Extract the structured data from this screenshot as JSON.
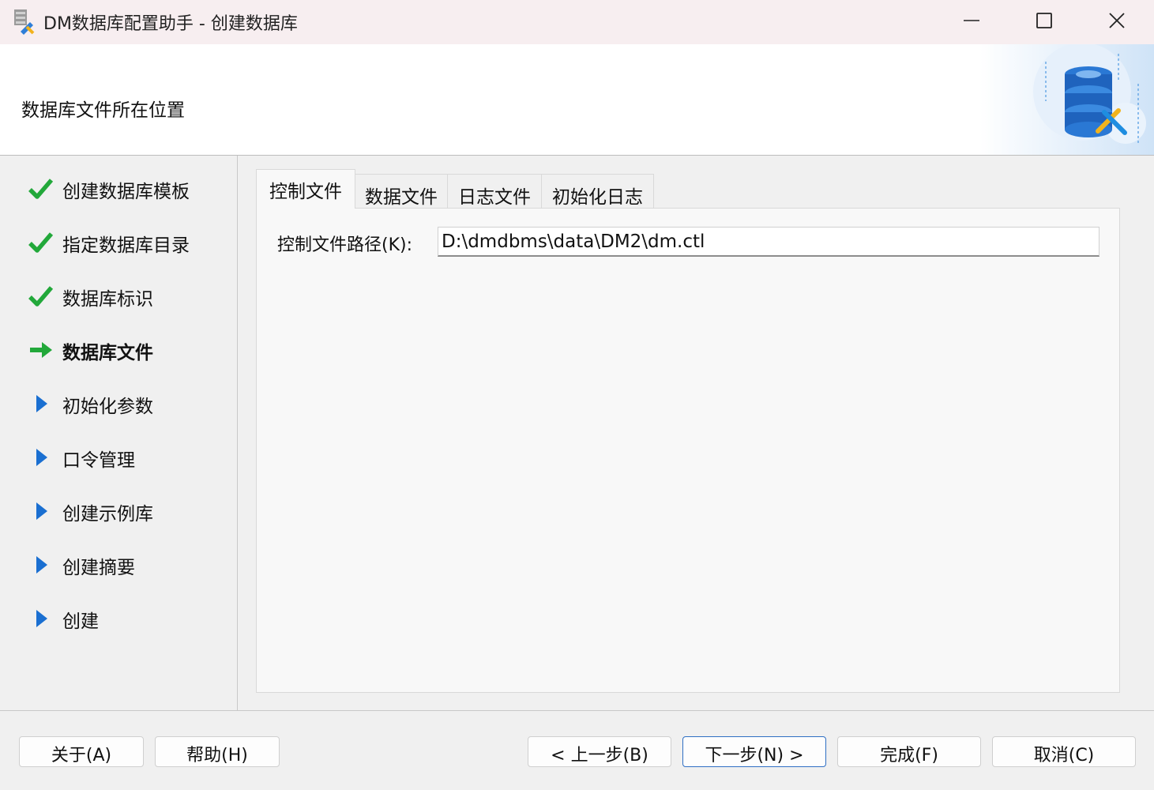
{
  "window": {
    "title": "DM数据库配置助手 - 创建数据库",
    "app_icon": "db-wrench-icon",
    "controls": [
      "minimize-icon",
      "maximize-icon",
      "close-icon"
    ]
  },
  "header": {
    "title": "数据库文件所在位置",
    "art_icon": "database-wrench-illustration"
  },
  "steps": [
    {
      "label": "创建数据库模板",
      "status": "done"
    },
    {
      "label": "指定数据库目录",
      "status": "done"
    },
    {
      "label": "数据库标识",
      "status": "done"
    },
    {
      "label": "数据库文件",
      "status": "current"
    },
    {
      "label": "初始化参数",
      "status": "pending"
    },
    {
      "label": "口令管理",
      "status": "pending"
    },
    {
      "label": "创建示例库",
      "status": "pending"
    },
    {
      "label": "创建摘要",
      "status": "pending"
    },
    {
      "label": "创建",
      "status": "pending"
    }
  ],
  "tabs": [
    {
      "label": "控制文件",
      "active": true
    },
    {
      "label": "数据文件",
      "active": false
    },
    {
      "label": "日志文件",
      "active": false
    },
    {
      "label": "初始化日志",
      "active": false
    }
  ],
  "control_file": {
    "path_label": "控制文件路径(K):",
    "path_value": "D:\\dmdbms\\data\\DM2\\dm.ctl"
  },
  "buttons": {
    "about": "关于(A)",
    "help": "帮助(H)",
    "back": "< 上一步(B)",
    "next": "下一步(N) >",
    "finish": "完成(F)",
    "cancel": "取消(C)"
  },
  "colors": {
    "check": "#22a83a",
    "arrow": "#22a83a",
    "pending_triangle": "#1a6fd1",
    "primary_border": "#2f6fc4"
  }
}
